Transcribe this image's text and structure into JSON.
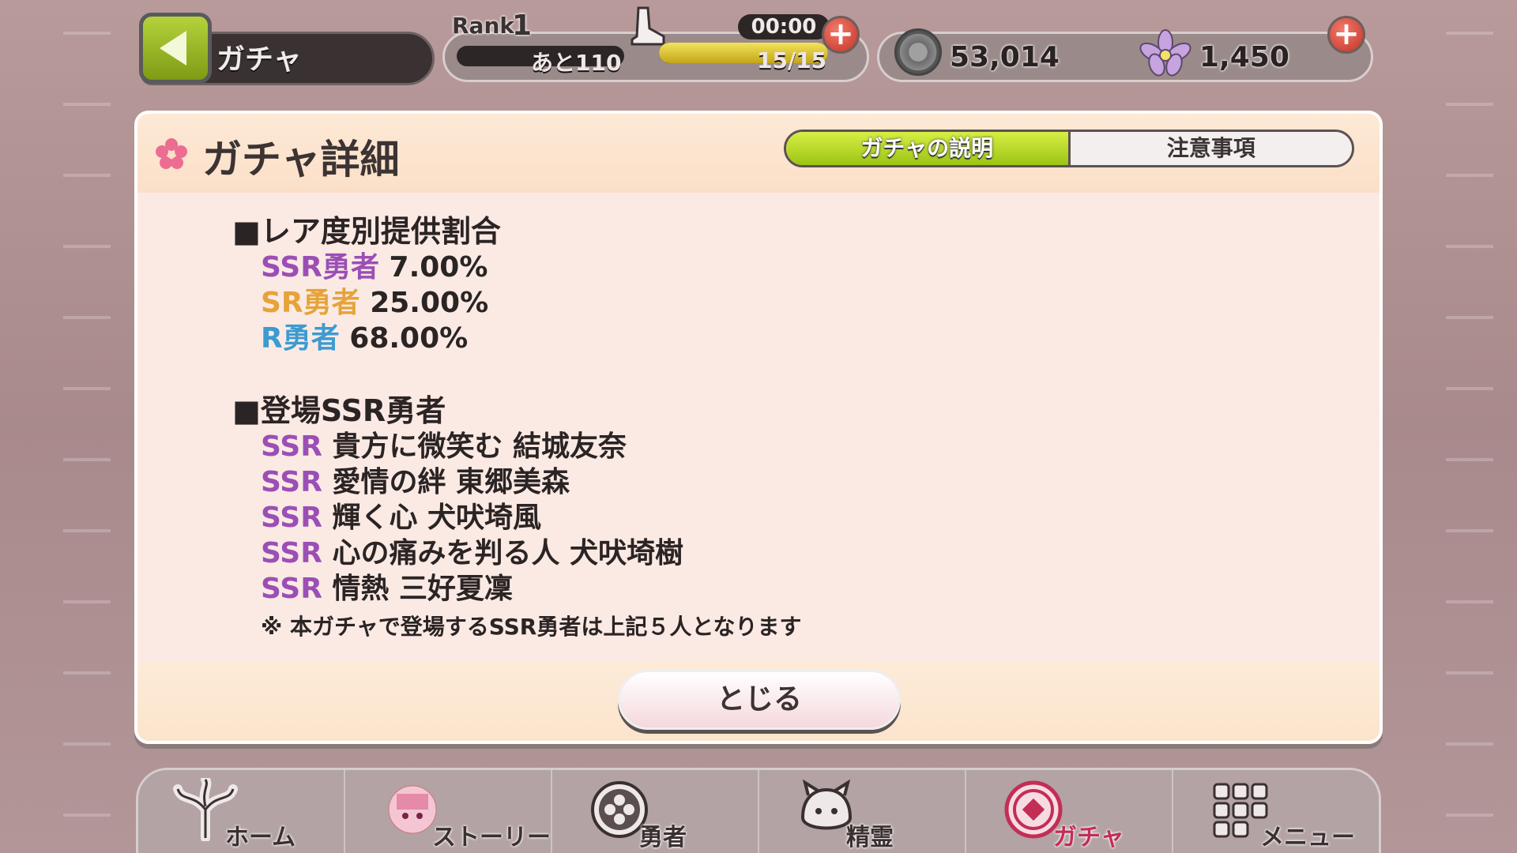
{
  "header": {
    "title": "ガチャ",
    "rank_label": "Rank",
    "rank_value": "1",
    "exp_remaining": "あと110",
    "stamina_timer": "00:00",
    "stamina": "15/15",
    "stamina_fraction": 1.0,
    "coins": "53,014",
    "gems": "1,450"
  },
  "dialog": {
    "title": "ガチャ詳細",
    "tabs": [
      {
        "label": "ガチャの説明",
        "active": true
      },
      {
        "label": "注意事項",
        "active": false
      }
    ],
    "rates_heading": "■レア度別提供割合",
    "rates": [
      {
        "rarity": "SSR勇者",
        "value": "7.00%"
      },
      {
        "rarity": "SR勇者",
        "value": "25.00%"
      },
      {
        "rarity": "R勇者",
        "value": "68.00%"
      }
    ],
    "heroes_heading": "■登場SSR勇者",
    "heroes": [
      {
        "rarity": "SSR",
        "name": "貴方に微笑む 結城友奈"
      },
      {
        "rarity": "SSR",
        "name": "愛情の絆 東郷美森"
      },
      {
        "rarity": "SSR",
        "name": "輝く心 犬吠埼風"
      },
      {
        "rarity": "SSR",
        "name": "心の痛みを判る人 犬吠埼樹"
      },
      {
        "rarity": "SSR",
        "name": "情熱 三好夏凜"
      }
    ],
    "note": "※ 本ガチャで登場するSSR勇者は上記５人となります",
    "close_label": "とじる"
  },
  "nav": [
    {
      "label": "ホーム",
      "icon": "home-tree-icon",
      "active": false
    },
    {
      "label": "ストーリー",
      "icon": "story-character-icon",
      "active": false
    },
    {
      "label": "勇者",
      "icon": "hero-emblem-icon",
      "active": false
    },
    {
      "label": "精霊",
      "icon": "spirit-icon",
      "active": false
    },
    {
      "label": "ガチャ",
      "icon": "gacha-emblem-icon",
      "active": true
    },
    {
      "label": "メニュー",
      "icon": "menu-grid-icon",
      "active": false
    }
  ],
  "colors": {
    "ssr": "#9b4fb5",
    "sr": "#e6a33a",
    "r": "#3c9bd1",
    "accent_green": "#9cc414",
    "active_nav": "#e24c7b"
  }
}
